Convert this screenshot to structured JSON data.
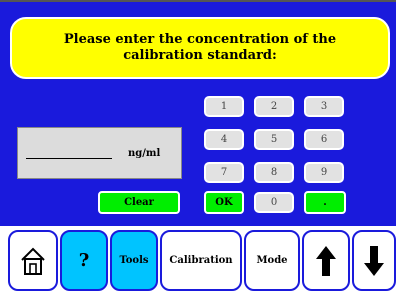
{
  "banner": {
    "message": "Please enter the concentration of the calibration standard:"
  },
  "entry": {
    "value": "",
    "unit": "ng/ml"
  },
  "keypad": {
    "keys": [
      "1",
      "2",
      "3",
      "4",
      "5",
      "6",
      "7",
      "8",
      "9",
      "0"
    ],
    "clear_label": "Clear",
    "ok_label": "OK",
    "decimal_label": "."
  },
  "toolbar": {
    "home_icon": "home-icon",
    "help_label": "?",
    "tools_label": "Tools",
    "calibration_label": "Calibration",
    "mode_label": "Mode",
    "up_icon": "arrow-up-icon",
    "down_icon": "arrow-down-icon"
  },
  "colors": {
    "background": "#1a1adc",
    "banner": "#ffff00",
    "accent_green": "#00ee00",
    "accent_cyan": "#00c4ff"
  }
}
